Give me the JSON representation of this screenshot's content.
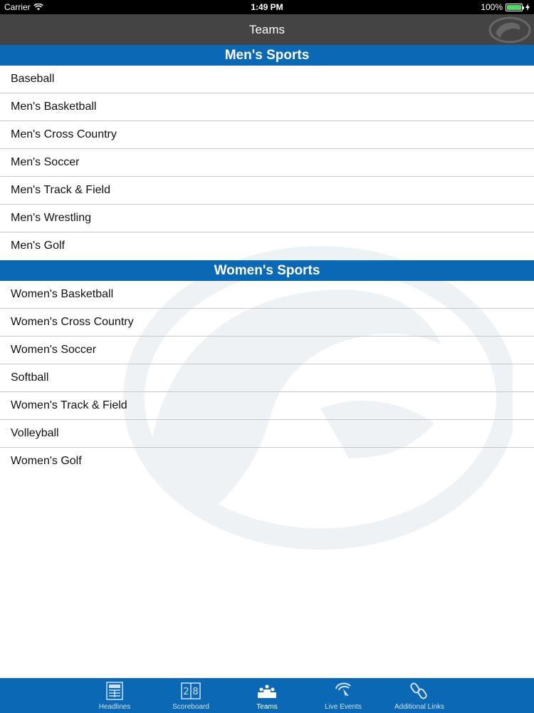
{
  "status_bar": {
    "carrier": "Carrier",
    "time": "1:49 PM",
    "battery": "100%"
  },
  "nav": {
    "title": "Teams"
  },
  "sections": [
    {
      "header": "Men's Sports",
      "items": [
        "Baseball",
        "Men's Basketball",
        "Men's Cross Country",
        "Men's Soccer",
        "Men's Track & Field",
        "Men's Wrestling",
        "Men's Golf"
      ]
    },
    {
      "header": "Women's Sports",
      "items": [
        "Women's Basketball",
        "Women's Cross Country",
        "Women's Soccer",
        "Softball",
        "Women's Track & Field",
        "Volleyball",
        "Women's Golf"
      ]
    }
  ],
  "tabs": [
    {
      "label": "Headlines",
      "icon": "newspaper-icon",
      "active": false
    },
    {
      "label": "Scoreboard",
      "icon": "scoreboard-icon",
      "active": false
    },
    {
      "label": "Teams",
      "icon": "podium-icon",
      "active": true
    },
    {
      "label": "Live Events",
      "icon": "live-events-icon",
      "active": false
    },
    {
      "label": "Additional Links",
      "icon": "links-icon",
      "active": false
    }
  ],
  "colors": {
    "brand_blue": "#0b68b4",
    "nav_gray": "#444444",
    "battery_green": "#4cd964"
  }
}
